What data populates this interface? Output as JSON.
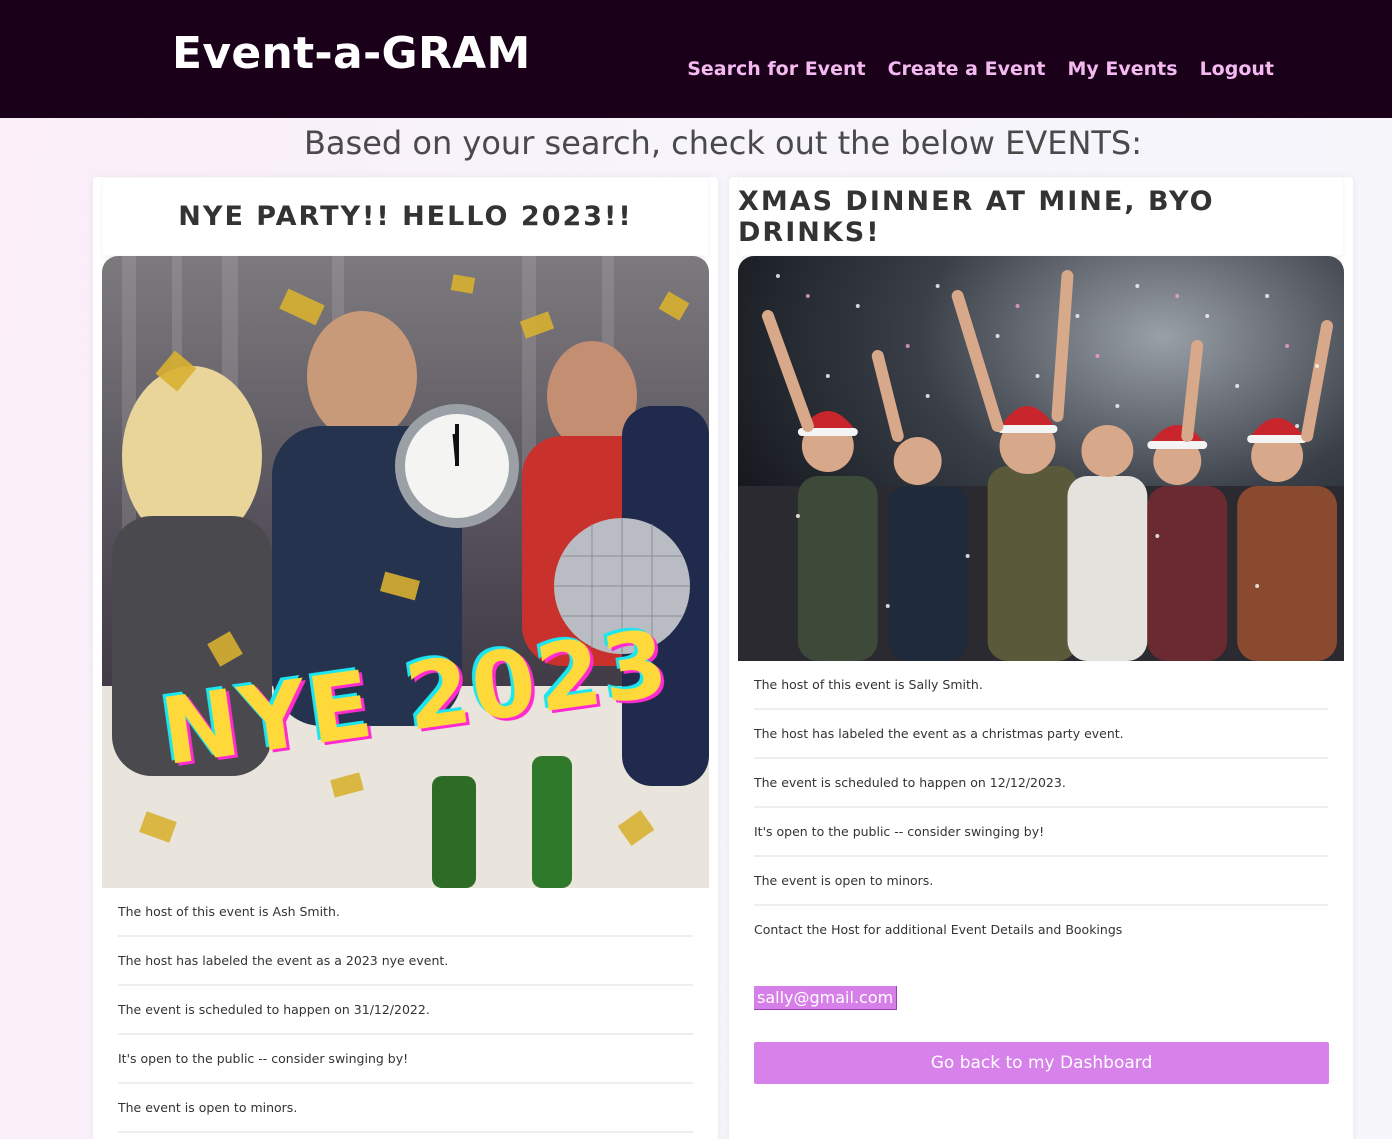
{
  "nav": {
    "brand": "Event-a-GRAM",
    "links": [
      "Search for Event",
      "Create a Event",
      "My Events",
      "Logout"
    ]
  },
  "heading": "Based on your search, check out the below EVENTS:",
  "events": [
    {
      "title": "NYE PARTY!! HELLO 2023!!",
      "image_overlay_text": "NYE 2023",
      "details": [
        "The host of this event is Ash Smith.",
        "The host has labeled the event as a 2023 nye event.",
        "The event is scheduled to happen on 31/12/2022.",
        "It's open to the public -- consider swinging by!",
        "The event is open to minors."
      ]
    },
    {
      "title": "XMAS DINNER AT MINE, BYO DRINKS!",
      "details": [
        "The host of this event is Sally Smith.",
        "The host has labeled the event as a christmas party event.",
        "The event is scheduled to happen on 12/12/2023.",
        "It's open to the public -- consider swinging by!",
        "The event is open to minors.",
        "Contact the Host for additional Event Details and Bookings"
      ],
      "email": "sally@gmail.com",
      "button_label": "Go back to my Dashboard"
    }
  ],
  "colors": {
    "navbar": "#1a0018",
    "nav_link": "#f4b9f1",
    "accent_button": "#d682ea"
  }
}
